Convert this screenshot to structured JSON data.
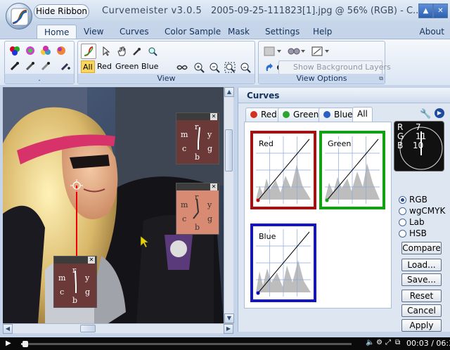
{
  "window": {
    "app_title": "Curvemeister v3.0.5",
    "file_title": "2005-09-25-111823[1].jpg @ 56% (RGB) - C...",
    "hide_ribbon": "Hide Ribbon",
    "min_glyph": "▲",
    "close_glyph": "✕"
  },
  "tabs": [
    "Home",
    "View",
    "Curves",
    "Color Sample",
    "Mask",
    "Settings",
    "Help"
  ],
  "about": "About",
  "ribbon": {
    "group_left_label": ".",
    "view_label": "View",
    "view_options_label": "View Options",
    "channels": [
      "All",
      "Red",
      "Green",
      "Blue"
    ],
    "show_bg_layers": "Show Background Layers"
  },
  "panel": {
    "title": "Curves",
    "tabs": [
      {
        "label": "Red",
        "color": "#d43020"
      },
      {
        "label": "Green",
        "color": "#2ea32e"
      },
      {
        "label": "Blue",
        "color": "#2a5fc4"
      },
      {
        "label": "All",
        "color": ""
      }
    ]
  },
  "curves": [
    {
      "label": "Red",
      "border": "#a11212"
    },
    {
      "label": "Green",
      "border": "#12a112"
    },
    {
      "label": "Blue",
      "border": "#1616b0"
    }
  ],
  "readout": {
    "r_label": "R",
    "g_label": "G",
    "b_label": "B",
    "r": "7",
    "g": "11",
    "b": "10"
  },
  "modes": {
    "options": [
      "RGB",
      "wgCMYK",
      "Lab",
      "HSB"
    ],
    "selected": "RGB"
  },
  "buttons": {
    "compare": "Compare",
    "load": "Load...",
    "save": "Save...",
    "reset": "Reset",
    "cancel": "Cancel",
    "apply": "Apply"
  },
  "media": {
    "time": "00:03 / 06:32",
    "progress": 0.008
  },
  "overlays": {
    "clock_letters": [
      "r",
      "y",
      "g",
      "b",
      "c",
      "m"
    ]
  }
}
